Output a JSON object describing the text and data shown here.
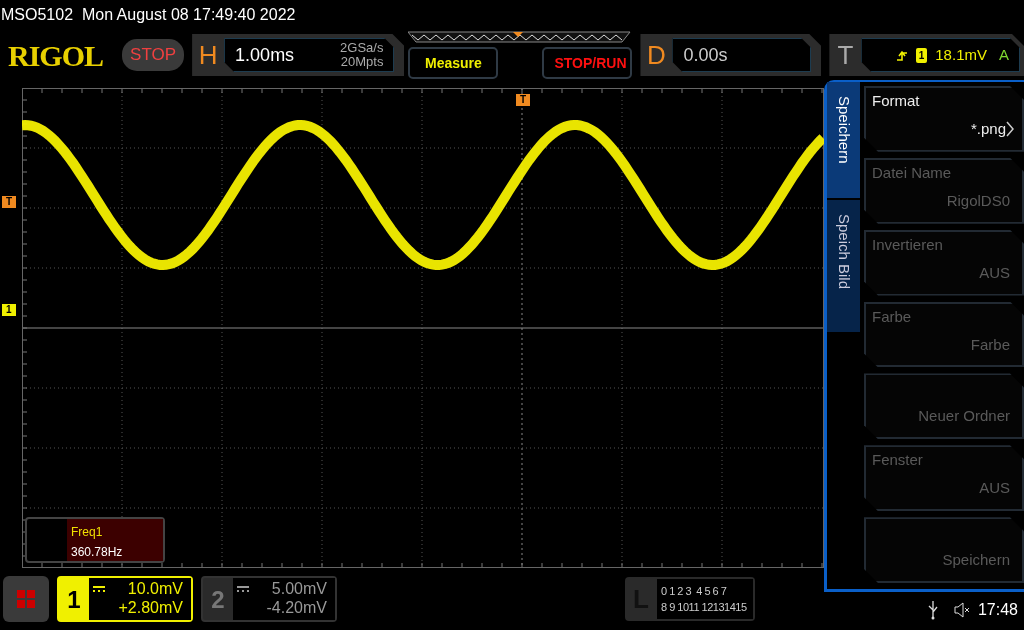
{
  "title": "MSO5102  Mon August 08 17:49:40 2022",
  "logo": "RIGOL",
  "run_state": "STOP",
  "horizontal": {
    "label": "H",
    "timebase": "1.00ms",
    "sample_rate": "2GSa/s",
    "memory_depth": "20Mpts"
  },
  "buttons": [
    {
      "label": "Measure",
      "kind": "measure"
    },
    {
      "label": "STOP/RUN",
      "kind": "stoprun"
    }
  ],
  "delay": {
    "label": "D",
    "value": "0.00s"
  },
  "trigger": {
    "label": "T",
    "source": "1",
    "level": "18.1mV",
    "mode": "A"
  },
  "markers": {
    "trigger_position": "T",
    "trigger_level": "T",
    "channel": "1"
  },
  "measurement": {
    "name": "Freq1",
    "value": "360.78Hz"
  },
  "menu": {
    "tabs": [
      {
        "label": "Speichern",
        "selected": true
      },
      {
        "label": "Speich Bild",
        "selected": false
      }
    ],
    "items": [
      {
        "label": "Format",
        "value": "*.png",
        "disabled": false,
        "submenu": true
      },
      {
        "label": "Datei Name",
        "value": "RigolDS0",
        "disabled": true,
        "submenu": false
      },
      {
        "label": "Invertieren",
        "value": "AUS",
        "disabled": true,
        "submenu": false
      },
      {
        "label": "Farbe",
        "value": "Farbe",
        "disabled": true,
        "submenu": false
      },
      {
        "value": "Neuer Ordner",
        "disabled": true,
        "submenu": false
      },
      {
        "label": "Fenster",
        "value": "AUS",
        "disabled": true,
        "submenu": false
      },
      {
        "value": "Speichern",
        "disabled": true,
        "submenu": false
      }
    ]
  },
  "channels": [
    {
      "number": "1",
      "scale": "10.0mV",
      "offset": "+2.80mV",
      "selected": true
    },
    {
      "number": "2",
      "scale": "5.00mV",
      "offset": "-4.20mV",
      "selected": false
    }
  ],
  "logic": {
    "label": "L",
    "rows": [
      "0 1 2 3  4 5 6 7",
      "8 9 1011 12131415"
    ]
  },
  "status": {
    "time": "17:48"
  }
}
